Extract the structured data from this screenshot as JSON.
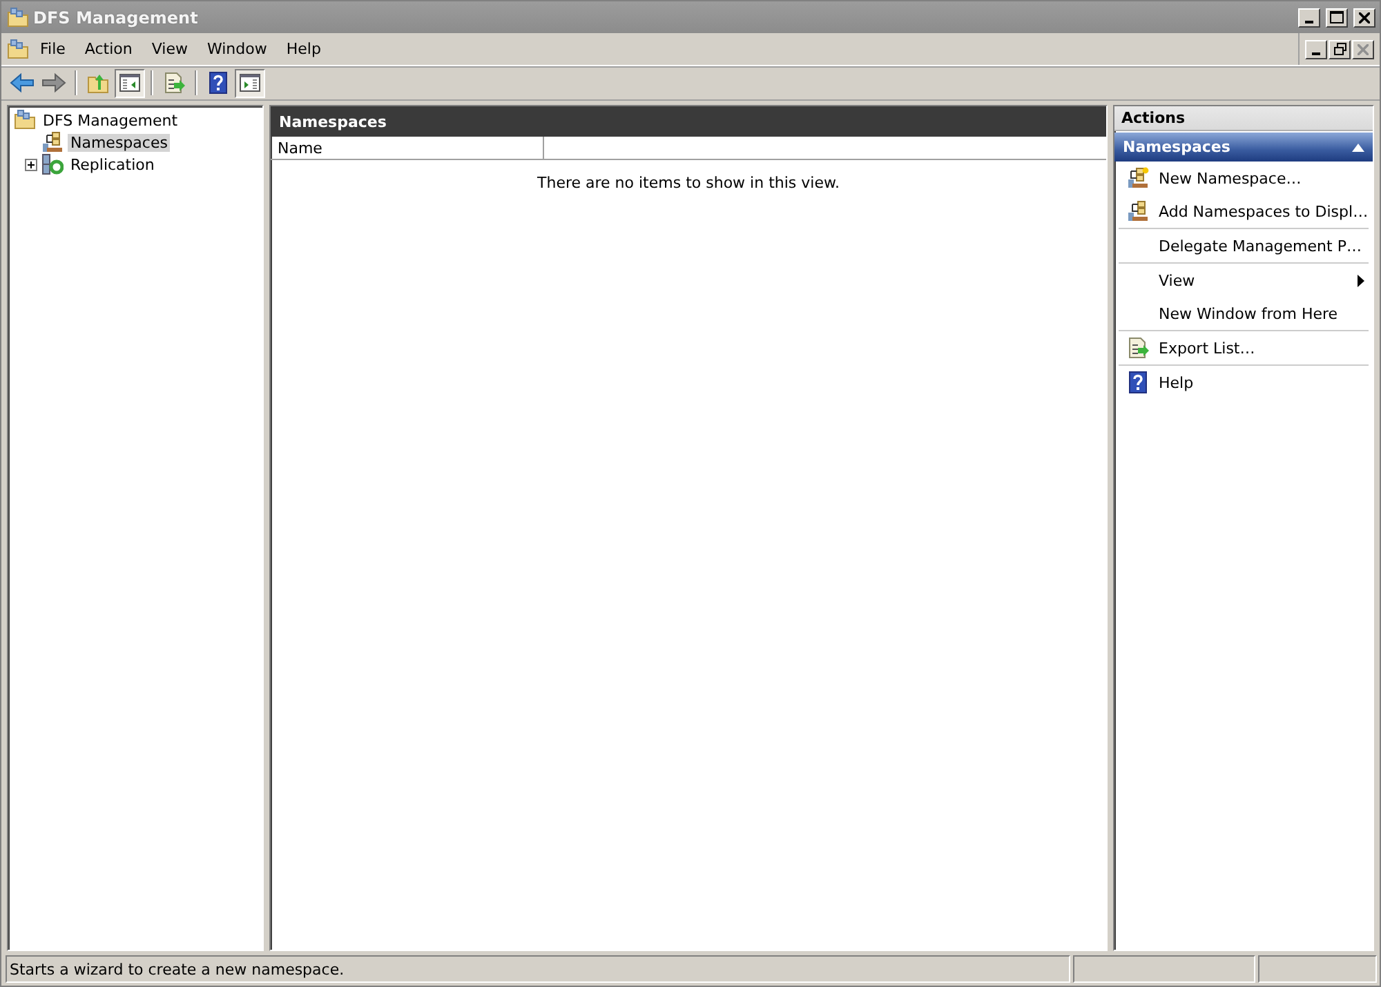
{
  "window": {
    "title": "DFS Management"
  },
  "menu": [
    "File",
    "Action",
    "View",
    "Window",
    "Help"
  ],
  "toolbar": [
    {
      "kind": "back",
      "pressed": false
    },
    {
      "kind": "forward",
      "pressed": false
    },
    {
      "kind": "sep"
    },
    {
      "kind": "up",
      "pressed": false
    },
    {
      "kind": "tree",
      "pressed": true
    },
    {
      "kind": "sep"
    },
    {
      "kind": "export",
      "pressed": false
    },
    {
      "kind": "sep"
    },
    {
      "kind": "help",
      "pressed": false
    },
    {
      "kind": "actionpane",
      "pressed": true
    }
  ],
  "tree": [
    {
      "label": "DFS Management",
      "kind": "root",
      "selected": false,
      "children": [
        {
          "label": "Namespaces",
          "kind": "namespaces",
          "selected": true
        },
        {
          "label": "Replication",
          "kind": "replication",
          "selected": false,
          "expanded": false
        }
      ]
    }
  ],
  "center": {
    "title": "Namespaces",
    "columns": [
      "Name"
    ],
    "empty_message": "There are no items to show in this view."
  },
  "actions": {
    "title": "Actions",
    "section": {
      "title": "Namespaces",
      "expanded": true
    },
    "items": [
      {
        "label": "New Namespace…",
        "kind": "namespace-new",
        "submenu": false,
        "separator_after": false
      },
      {
        "label": "Add Namespaces to Displ…",
        "kind": "namespace",
        "submenu": false,
        "separator_after": true
      },
      {
        "label": "Delegate Management P…",
        "kind": "plain",
        "submenu": false,
        "separator_after": true
      },
      {
        "label": "View",
        "kind": "plain",
        "submenu": true,
        "separator_after": false
      },
      {
        "label": "New Window from Here",
        "kind": "plain",
        "submenu": false,
        "separator_after": true
      },
      {
        "label": "Export List…",
        "kind": "export",
        "submenu": false,
        "separator_after": true
      },
      {
        "label": "Help",
        "kind": "help",
        "submenu": false,
        "separator_after": false
      }
    ]
  },
  "status_bar": {
    "text": "Starts a wizard to create a new namespace."
  }
}
